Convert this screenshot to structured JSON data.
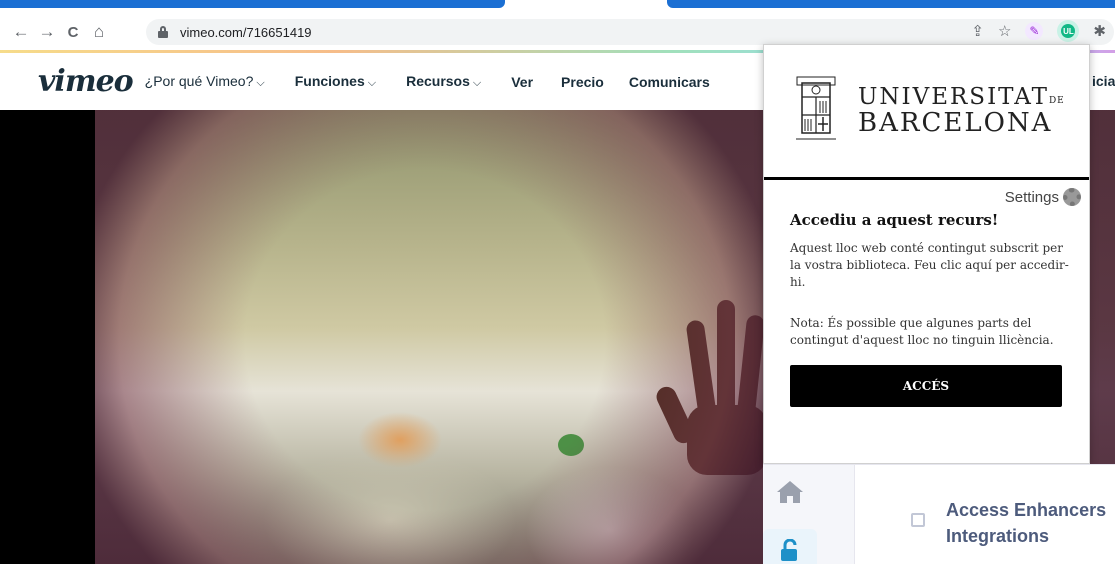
{
  "browser": {
    "url": "vimeo.com/716651419",
    "nav": {
      "back": "←",
      "forward": "→",
      "reload": "C",
      "home": "⌂"
    },
    "omni_icons": {
      "share": "⇪",
      "star": "☆",
      "pen": "✎",
      "ub": "UL",
      "puzzle": "✱"
    }
  },
  "vimeo": {
    "logo": "vimeo",
    "menu": [
      {
        "label": "¿Por qué Vimeo?",
        "chevron": "⌵"
      },
      {
        "label": "Funciones",
        "chevron": "⌵"
      },
      {
        "label": "Recursos",
        "chevron": "⌵"
      },
      {
        "label": "Ver",
        "chevron": ""
      },
      {
        "label": "Precio",
        "chevron": ""
      },
      {
        "label": "Comunicars",
        "chevron": ""
      }
    ],
    "right_partial": "icia"
  },
  "popup": {
    "org_line1": "UNIVERSITAT",
    "org_de": "DE",
    "org_line2": "BARCELONA",
    "settings_label": "Settings",
    "title": "Accediu a aquest recurs!",
    "text1": "Aquest lloc web conté contingut subscrit per la vostra biblioteca. Feu clic aquí per accedir-hi.",
    "text2": "Nota: És possible que algunes parts del contingut d'aquest lloc no tinguin llicència.",
    "button_label": "ACCÉS"
  },
  "panel": {
    "title_line1": "Access Enhancers",
    "title_line2": "Integrations"
  },
  "colors": {
    "tab_accent": "#1b6fd3",
    "vimeo_navy": "#1a2e3b",
    "panel_title": "#4d5b7c",
    "unlock_blue": "#1e90c8"
  }
}
